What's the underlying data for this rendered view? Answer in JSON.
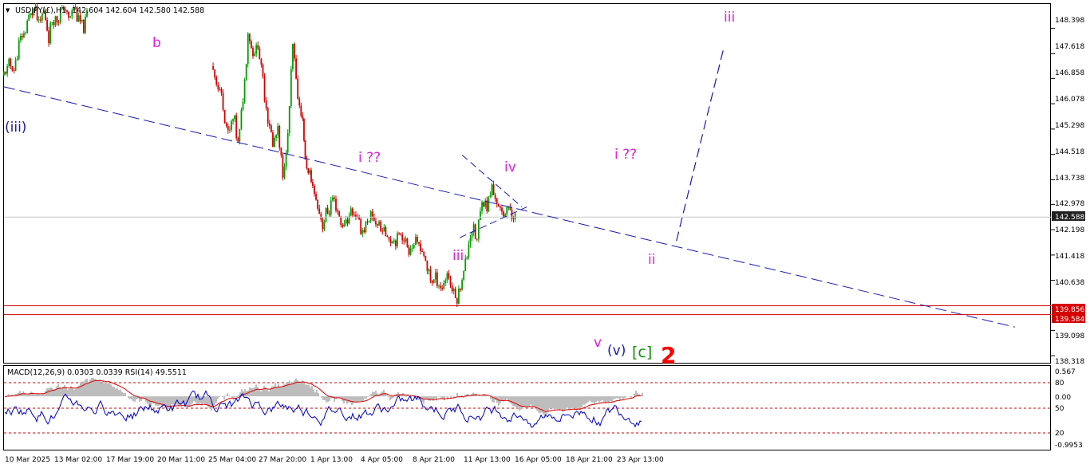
{
  "header": {
    "symbol_label": "USDJPY(£),H1",
    "ohlc_label": "142.604 142.604 142.580 142.588",
    "dropdown_glyph": "▼"
  },
  "indicator_header": {
    "label": "MACD(12,26,9) 0.0303 0.0339  RSI(14) 49.5511"
  },
  "colors": {
    "bullish": "#00a000",
    "bearish": "#d40000",
    "trendline": "#1a1ab4",
    "wave_magenta": "#e020e0",
    "wave_blue": "#1a1ab4",
    "wave_green": "#10900a",
    "wave_red": "#ff0000",
    "support": "#d40000",
    "price_tag": "#222222"
  },
  "price_scale": {
    "labels": [
      "148.398",
      "147.618",
      "146.858",
      "146.078",
      "145.298",
      "144.518",
      "143.738",
      "142.978",
      "142.198",
      "141.418",
      "140.638",
      "139.098",
      "138.318"
    ],
    "current_price": "142.588",
    "support_labels": [
      "139.856",
      "139.584"
    ]
  },
  "indicator_scale": {
    "labels": [
      "0.567",
      "80",
      "0.00",
      "50",
      "20",
      "-0.9953"
    ]
  },
  "time_axis": {
    "labels": [
      "10 Mar 2025",
      "13 Mar 02:00",
      "17 Mar 19:00",
      "20 Mar 11:00",
      "25 Mar 04:00",
      "27 Mar 20:00",
      "1 Apr 13:00",
      "4 Apr 05:00",
      "8 Apr 21:00",
      "11 Apr 13:00",
      "16 Apr 05:00",
      "18 Apr 21:00",
      "23 Apr 13:00"
    ]
  },
  "wave_labels": {
    "b": "b",
    "iii_blue": "(iii)",
    "i_q_first": "i ??",
    "iii_small": "iii",
    "iv": "iv",
    "v": "v",
    "v_paren": "(v)",
    "c_bracket": "[c]",
    "two": "2",
    "i_q_second": "i ??",
    "ii": "ii",
    "iii_target": "iii"
  },
  "chart_data": {
    "type": "candlestick",
    "symbol": "USDJPY",
    "timeframe": "H1",
    "ylim": [
      138.1,
      149.15
    ],
    "current_price": 142.588,
    "support_levels": [
      139.856,
      139.584
    ],
    "price_path": [
      [
        0,
        146.9
      ],
      [
        2,
        147.3
      ],
      [
        4,
        147.1
      ],
      [
        6,
        147.9
      ],
      [
        8,
        148.2
      ],
      [
        10,
        148.7
      ],
      [
        12,
        149.1
      ],
      [
        14,
        148.6
      ],
      [
        16,
        148.9
      ],
      [
        18,
        148.2
      ],
      [
        20,
        148.7
      ],
      [
        22,
        148.8
      ],
      [
        24,
        149.0
      ],
      [
        26,
        148.7
      ],
      [
        28,
        149.1
      ],
      [
        30,
        148.7
      ],
      [
        32,
        148.3
      ],
      [
        34,
        149.0
      ],
      [
        84,
        147.3
      ],
      [
        86,
        146.6
      ],
      [
        88,
        146.1
      ],
      [
        90,
        145.1
      ],
      [
        92,
        145.7
      ],
      [
        94,
        144.9
      ],
      [
        96,
        146.2
      ],
      [
        98,
        148.3
      ],
      [
        100,
        147.6
      ],
      [
        102,
        147.9
      ],
      [
        104,
        146.8
      ],
      [
        106,
        145.7
      ],
      [
        108,
        144.8
      ],
      [
        110,
        145.3
      ],
      [
        112,
        143.8
      ],
      [
        114,
        145.1
      ],
      [
        116,
        147.8
      ],
      [
        118,
        146.3
      ],
      [
        120,
        145.6
      ],
      [
        121,
        144.3
      ],
      [
        124,
        143.5
      ],
      [
        128,
        142.4
      ],
      [
        132,
        143.1
      ],
      [
        136,
        142.3
      ],
      [
        140,
        142.8
      ],
      [
        144,
        142.2
      ],
      [
        148,
        142.6
      ],
      [
        152,
        142.2
      ],
      [
        156,
        141.9
      ],
      [
        160,
        142.1
      ],
      [
        162,
        141.6
      ],
      [
        166,
        141.8
      ],
      [
        168,
        141.5
      ],
      [
        170,
        141.0
      ],
      [
        172,
        140.6
      ],
      [
        174,
        140.7
      ],
      [
        176,
        140.4
      ],
      [
        178,
        140.8
      ],
      [
        180,
        140.4
      ],
      [
        182,
        140.1
      ],
      [
        184,
        140.7
      ],
      [
        186,
        141.5
      ],
      [
        188,
        142.3
      ],
      [
        190,
        141.9
      ],
      [
        192,
        143.2
      ],
      [
        194,
        142.9
      ],
      [
        196,
        143.5
      ],
      [
        198,
        143.0
      ],
      [
        200,
        142.7
      ],
      [
        202,
        142.9
      ],
      [
        204,
        142.6
      ],
      [
        206,
        142.588
      ]
    ],
    "projection": {
      "from_x": 206,
      "from": 141.85,
      "to_x": 225,
      "to": 147.8
    },
    "macd": {
      "signal_line": 0.0339,
      "histogram": 0.0303,
      "range": [
        -0.9953,
        0.567
      ]
    },
    "rsi": {
      "period": 14,
      "value": 49.5511,
      "levels": [
        80,
        50,
        20
      ]
    }
  }
}
